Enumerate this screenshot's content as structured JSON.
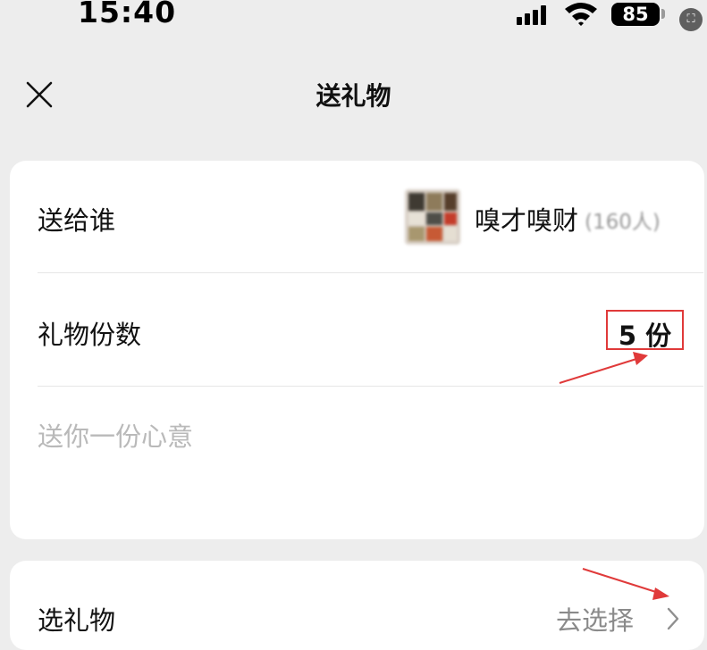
{
  "status_bar": {
    "time": "15:40",
    "battery": "85",
    "corner_icon": "⛶"
  },
  "nav": {
    "title": "送礼物"
  },
  "form": {
    "recipient_label": "送给谁",
    "recipient_name": "嗅才嗅财",
    "recipient_count": "(160人)",
    "gift_count_label": "礼物份数",
    "gift_count_value": "5 份",
    "message_placeholder": "送你一份心意"
  },
  "gift": {
    "label": "选礼物",
    "action": "去选择"
  },
  "colors": {
    "background": "#ededed",
    "card": "#ffffff",
    "annotation": "#e03a3a"
  },
  "icons": [
    "signal-icon",
    "wifi-icon",
    "battery-icon",
    "close-icon",
    "chevron-right-icon"
  ]
}
